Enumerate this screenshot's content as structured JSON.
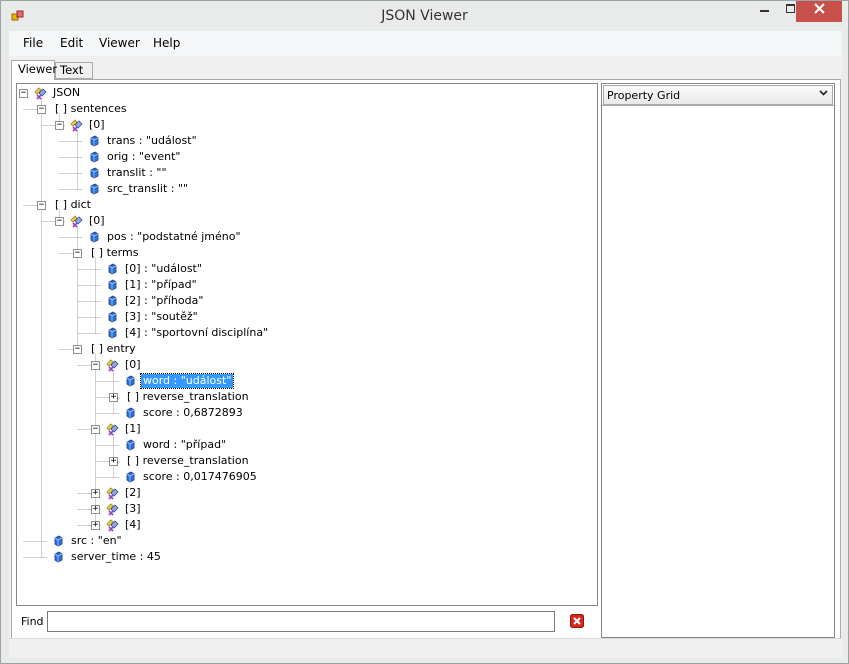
{
  "window": {
    "title": "JSON Viewer"
  },
  "menu": [
    "File",
    "Edit",
    "Viewer",
    "Help"
  ],
  "tabs": [
    "Viewer",
    "Text"
  ],
  "tree": [
    {
      "level": 0,
      "text": "JSON",
      "icon": "object-icon",
      "expander": "minus"
    },
    {
      "level": 1,
      "text": "[ ]  sentences",
      "icon": "none",
      "expander": "minus"
    },
    {
      "level": 2,
      "text": "[0]",
      "icon": "object-icon",
      "expander": "minus"
    },
    {
      "level": 3,
      "text": "trans : \"událost\"",
      "icon": "value-icon",
      "expander": "none"
    },
    {
      "level": 3,
      "text": "orig : \"event\"",
      "icon": "value-icon",
      "expander": "none"
    },
    {
      "level": 3,
      "text": "translit : \"\"",
      "icon": "value-icon",
      "expander": "none"
    },
    {
      "level": 3,
      "text": "src_translit : \"\"",
      "icon": "value-icon",
      "expander": "none"
    },
    {
      "level": 1,
      "text": "[ ]  dict",
      "icon": "none",
      "expander": "minus"
    },
    {
      "level": 2,
      "text": "[0]",
      "icon": "object-icon",
      "expander": "minus"
    },
    {
      "level": 3,
      "text": "pos : \"podstatné jméno\"",
      "icon": "value-icon",
      "expander": "none"
    },
    {
      "level": 3,
      "text": "[ ]  terms",
      "icon": "none",
      "expander": "minus"
    },
    {
      "level": 4,
      "text": "[0] : \"událost\"",
      "icon": "value-icon",
      "expander": "none"
    },
    {
      "level": 4,
      "text": "[1] : \"případ\"",
      "icon": "value-icon",
      "expander": "none"
    },
    {
      "level": 4,
      "text": "[2] : \"příhoda\"",
      "icon": "value-icon",
      "expander": "none"
    },
    {
      "level": 4,
      "text": "[3] : \"soutěž\"",
      "icon": "value-icon",
      "expander": "none"
    },
    {
      "level": 4,
      "text": "[4] : \"sportovní disciplína\"",
      "icon": "value-icon",
      "expander": "none"
    },
    {
      "level": 3,
      "text": "[ ]  entry",
      "icon": "none",
      "expander": "minus"
    },
    {
      "level": 4,
      "text": "[0]",
      "icon": "object-icon",
      "expander": "minus"
    },
    {
      "level": 5,
      "text": "word : \"událost\"",
      "icon": "value-icon",
      "expander": "none",
      "selected": true
    },
    {
      "level": 5,
      "text": "[ ]  reverse_translation",
      "icon": "none",
      "expander": "plus"
    },
    {
      "level": 5,
      "text": "score : 0,6872893",
      "icon": "value-icon",
      "expander": "none"
    },
    {
      "level": 4,
      "text": "[1]",
      "icon": "object-icon",
      "expander": "minus"
    },
    {
      "level": 5,
      "text": "word : \"případ\"",
      "icon": "value-icon",
      "expander": "none"
    },
    {
      "level": 5,
      "text": "[ ]  reverse_translation",
      "icon": "none",
      "expander": "plus"
    },
    {
      "level": 5,
      "text": "score : 0,017476905",
      "icon": "value-icon",
      "expander": "none"
    },
    {
      "level": 4,
      "text": "[2]",
      "icon": "object-icon",
      "expander": "plus"
    },
    {
      "level": 4,
      "text": "[3]",
      "icon": "object-icon",
      "expander": "plus"
    },
    {
      "level": 4,
      "text": "[4]",
      "icon": "object-icon",
      "expander": "plus"
    },
    {
      "level": 1,
      "text": "src : \"en\"",
      "icon": "value-icon",
      "expander": "none"
    },
    {
      "level": 1,
      "text": "server_time : 45",
      "icon": "value-icon",
      "expander": "none"
    }
  ],
  "property_grid": {
    "label": "Property Grid"
  },
  "find": {
    "label": "Find",
    "value": ""
  },
  "colors": {
    "selection": "#3399ff",
    "close_button": "#c7504b"
  }
}
